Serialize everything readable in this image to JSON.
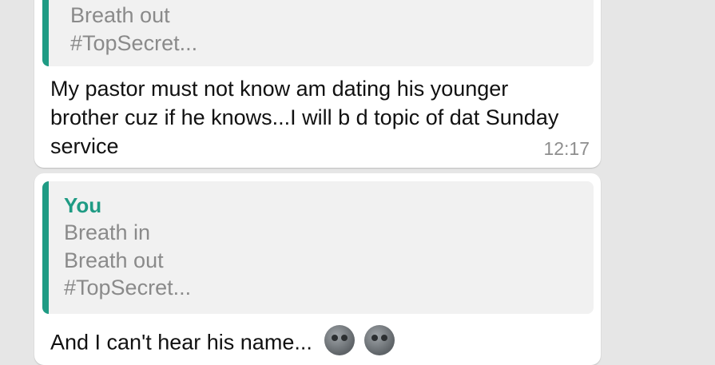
{
  "messages": [
    {
      "quote": {
        "lines": [
          "Breath out",
          "#TopSecret..."
        ]
      },
      "text": "My pastor must not know am dating his younger brother cuz if he knows...I will b d topic of dat Sunday service",
      "time": "12:17"
    },
    {
      "quote": {
        "author": "You",
        "lines": [
          "Breath in",
          "Breath out",
          "#TopSecret..."
        ]
      },
      "text": "And I can't hear his name...",
      "emoji": [
        "grimacing-face-emoji",
        "grimacing-face-emoji"
      ]
    }
  ],
  "colors": {
    "background": "#e6e6e6",
    "bubble": "#ffffff",
    "quote_background": "#f1f1f1",
    "accent": "#1f9b84",
    "quote_text": "#8a8a8a",
    "timestamp": "#8e8e8e"
  }
}
